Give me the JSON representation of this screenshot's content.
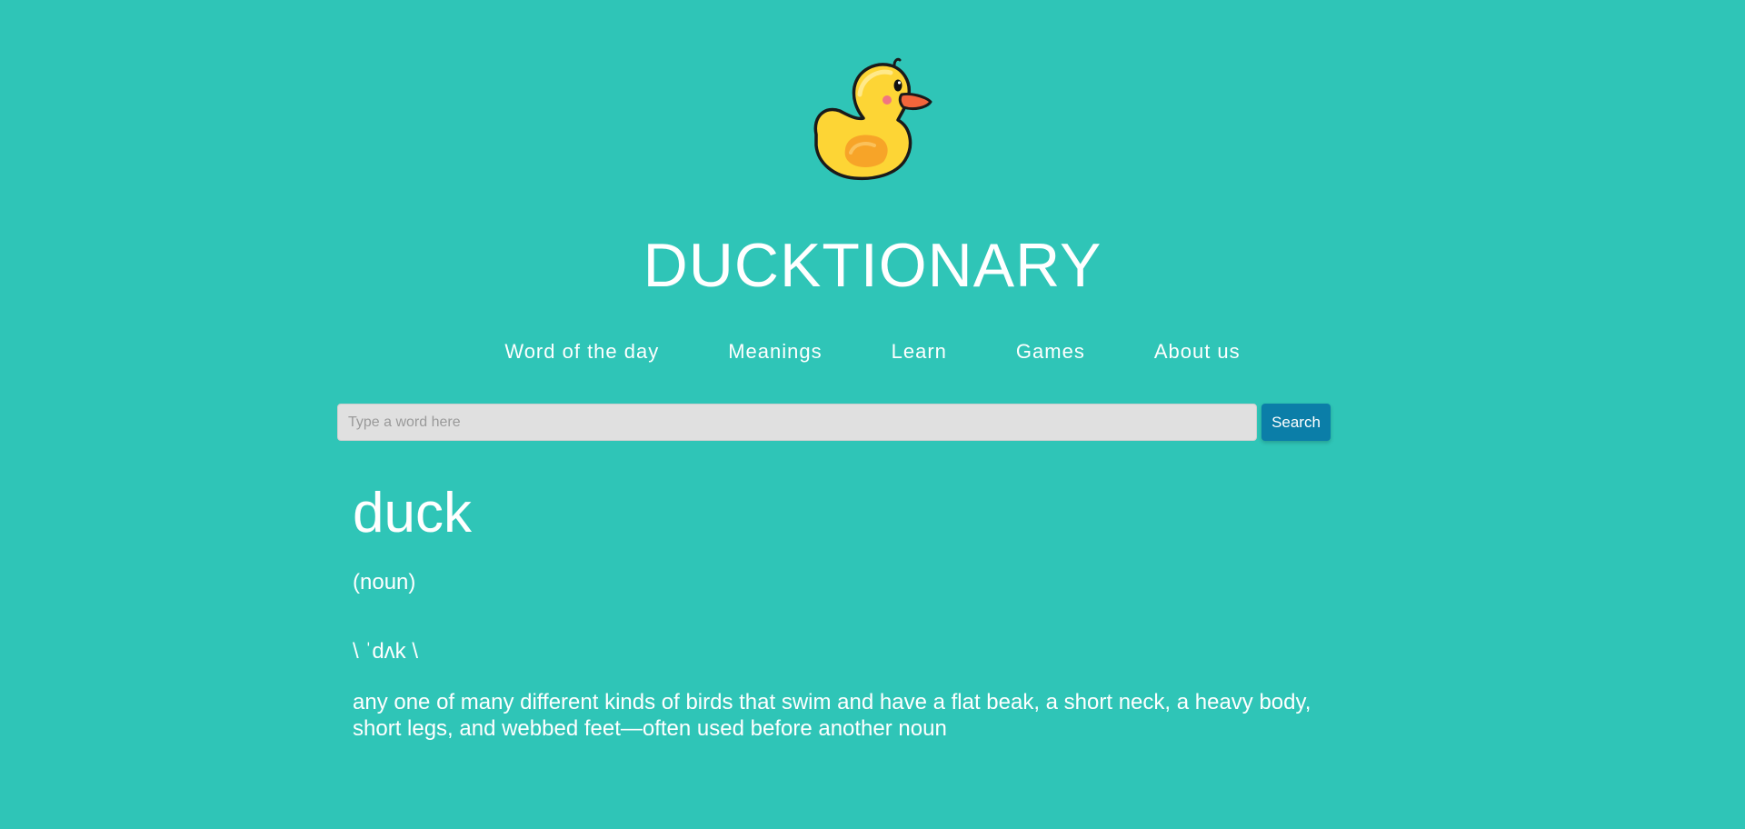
{
  "site": {
    "title": "DUCKTIONARY",
    "logo_icon": "rubber-duck-icon"
  },
  "nav": {
    "items": [
      {
        "label": "Word of the day"
      },
      {
        "label": "Meanings"
      },
      {
        "label": "Learn"
      },
      {
        "label": "Games"
      },
      {
        "label": "About us"
      }
    ]
  },
  "search": {
    "value": "",
    "placeholder": "Type a word here",
    "button_label": "Search"
  },
  "entry": {
    "word": "duck",
    "part_of_speech": "(noun)",
    "pronunciation": "\\ ˈdʌk \\",
    "definition": "any one of many different kinds of birds that swim and have a flat beak, a short neck, a heavy body, short legs, and webbed feet—often used before another noun"
  },
  "colors": {
    "background": "#2fc5b7",
    "search_button": "#0b7ea8",
    "search_input": "#e0e0e0",
    "text": "#ffffff"
  }
}
